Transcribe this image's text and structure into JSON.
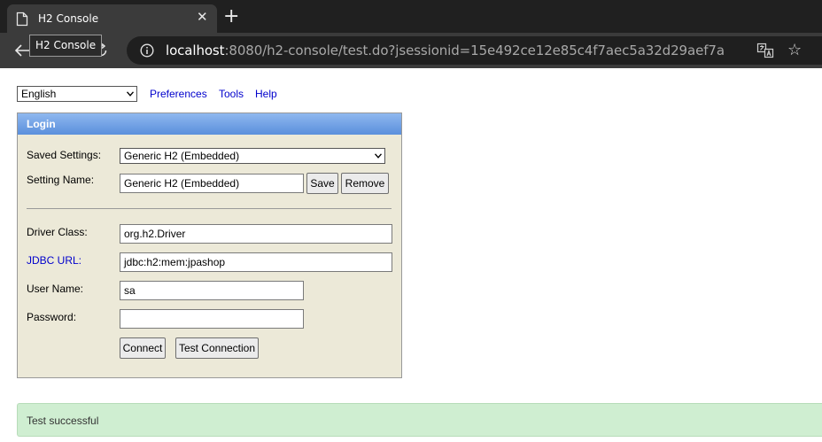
{
  "browser": {
    "tab_title": "H2 Console",
    "tab_close": "✕",
    "new_tab": "+",
    "tooltip": "H2 Console",
    "url_host": "localhost",
    "url_rest": ":8080/h2-console/test.do?jsessionid=15e492ce12e85c4f7aec5a32d29aef7a",
    "star": "☆"
  },
  "topbar": {
    "language": "English",
    "links": [
      "Preferences",
      "Tools",
      "Help"
    ]
  },
  "login": {
    "header": "Login",
    "saved_settings_label": "Saved Settings:",
    "saved_settings_value": "Generic H2 (Embedded)",
    "setting_name_label": "Setting Name:",
    "setting_name_value": "Generic H2 (Embedded)",
    "save_label": "Save",
    "remove_label": "Remove",
    "driver_class_label": "Driver Class:",
    "driver_class_value": "org.h2.Driver",
    "jdbc_url_label": "JDBC URL:",
    "jdbc_url_value": "jdbc:h2:mem:jpashop",
    "user_name_label": "User Name:",
    "user_name_value": "sa",
    "password_label": "Password:",
    "password_value": "",
    "connect_label": "Connect",
    "test_connection_label": "Test Connection"
  },
  "status": {
    "message": "Test successful"
  },
  "colors": {
    "link": "#0000cc",
    "panel_bg": "#ece9d8",
    "header_blue": "#5a8fdc",
    "status_green": "#cfeed1"
  }
}
